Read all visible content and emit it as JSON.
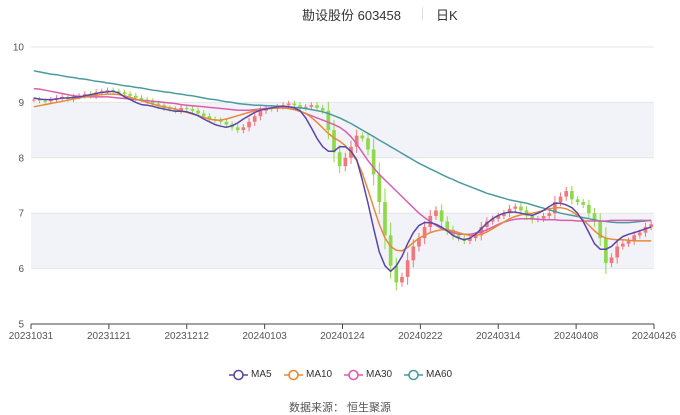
{
  "header": {
    "stock_label": "勘设股份 603458",
    "period_label": "日K"
  },
  "source": {
    "text": "数据来源：  恒生聚源"
  },
  "colors": {
    "up": "#f0787a",
    "down": "#8ed94b",
    "ma5": "#5b45a8",
    "ma10": "#e8893a",
    "ma30": "#d85fae",
    "ma60": "#4b9aa0",
    "band": "#f2f3f9",
    "grid": "#e6e6e6"
  },
  "chart_data": {
    "type": "candlestick",
    "ylim": [
      5,
      10
    ],
    "y_ticks": [
      "5",
      "6",
      "7",
      "8",
      "9",
      "10"
    ],
    "x_ticks": [
      "20231031",
      "20231121",
      "20231212",
      "20240103",
      "20240124",
      "20240222",
      "20240314",
      "20240408",
      "20240426"
    ],
    "legend": [
      "MA5",
      "MA10",
      "MA30",
      "MA60"
    ],
    "closes": [
      9.05,
      9.03,
      9.02,
      9.05,
      9.08,
      9.1,
      9.06,
      9.1,
      9.12,
      9.15,
      9.12,
      9.18,
      9.2,
      9.22,
      9.2,
      9.18,
      9.15,
      9.12,
      9.08,
      9.05,
      9.02,
      8.98,
      8.95,
      8.9,
      8.88,
      8.85,
      8.9,
      8.88,
      8.85,
      8.8,
      8.75,
      8.7,
      8.68,
      8.65,
      8.6,
      8.55,
      8.5,
      8.55,
      8.65,
      8.75,
      8.85,
      8.9,
      8.88,
      8.92,
      8.95,
      8.98,
      8.95,
      8.9,
      8.92,
      8.95,
      8.9,
      8.85,
      8.5,
      8.1,
      7.85,
      8.0,
      8.2,
      8.4,
      8.35,
      8.15,
      7.7,
      7.2,
      6.6,
      6.05,
      5.75,
      5.85,
      6.15,
      6.4,
      6.55,
      6.75,
      6.95,
      7.05,
      6.85,
      6.7,
      6.6,
      6.55,
      6.5,
      6.55,
      6.6,
      6.75,
      6.85,
      6.9,
      6.95,
      7.0,
      7.08,
      7.12,
      7.05,
      6.95,
      6.88,
      6.9,
      6.95,
      7.0,
      7.2,
      7.3,
      7.4,
      7.25,
      7.2,
      7.15,
      7.0,
      6.85,
      6.55,
      6.1,
      6.2,
      6.4,
      6.45,
      6.5,
      6.6,
      6.65,
      6.75,
      6.8
    ],
    "ma5": [
      9.08,
      9.06,
      9.05,
      9.05,
      9.06,
      9.08,
      9.08,
      9.09,
      9.1,
      9.12,
      9.14,
      9.16,
      9.18,
      9.19,
      9.2,
      9.17,
      9.1,
      9.05,
      9.0,
      8.96,
      8.95,
      8.93,
      8.9,
      8.88,
      8.86,
      8.84,
      8.84,
      8.83,
      8.8,
      8.76,
      8.7,
      8.65,
      8.6,
      8.57,
      8.55,
      8.58,
      8.63,
      8.7,
      8.76,
      8.82,
      8.86,
      8.88,
      8.9,
      8.92,
      8.93,
      8.92,
      8.9,
      8.85,
      8.72,
      8.54,
      8.35,
      8.2,
      8.12,
      8.12,
      8.2,
      8.2,
      8.12,
      7.97,
      7.6,
      7.18,
      6.72,
      6.3,
      6.05,
      5.95,
      6.05,
      6.22,
      6.45,
      6.65,
      6.78,
      6.83,
      6.83,
      6.8,
      6.75,
      6.68,
      6.6,
      6.55,
      6.52,
      6.55,
      6.62,
      6.72,
      6.82,
      6.9,
      6.96,
      7.0,
      7.02,
      7.02,
      7.0,
      6.98,
      6.96,
      7.0,
      7.05,
      7.12,
      7.18,
      7.18,
      7.15,
      7.1,
      7.0,
      6.85,
      6.65,
      6.45,
      6.35,
      6.35,
      6.4,
      6.5,
      6.58,
      6.62,
      6.65,
      6.68,
      6.72,
      6.75
    ],
    "ma10": [
      8.92,
      8.94,
      8.96,
      8.98,
      9.0,
      9.02,
      9.04,
      9.06,
      9.08,
      9.1,
      9.12,
      9.13,
      9.14,
      9.15,
      9.15,
      9.14,
      9.12,
      9.09,
      9.06,
      9.03,
      9.0,
      8.97,
      8.94,
      8.92,
      8.9,
      8.88,
      8.85,
      8.82,
      8.79,
      8.76,
      8.73,
      8.7,
      8.68,
      8.68,
      8.7,
      8.73,
      8.76,
      8.79,
      8.82,
      8.85,
      8.87,
      8.88,
      8.89,
      8.9,
      8.9,
      8.89,
      8.87,
      8.84,
      8.8,
      8.73,
      8.64,
      8.54,
      8.44,
      8.36,
      8.3,
      8.22,
      8.1,
      7.95,
      7.72,
      7.42,
      7.1,
      6.8,
      6.55,
      6.4,
      6.33,
      6.32,
      6.38,
      6.47,
      6.55,
      6.6,
      6.65,
      6.68,
      6.7,
      6.7,
      6.68,
      6.65,
      6.62,
      6.6,
      6.6,
      6.62,
      6.66,
      6.72,
      6.78,
      6.84,
      6.9,
      6.94,
      6.97,
      6.99,
      7.0,
      7.02,
      7.05,
      7.08,
      7.1,
      7.1,
      7.08,
      7.03,
      6.96,
      6.88,
      6.78,
      6.68,
      6.6,
      6.55,
      6.53,
      6.52,
      6.52,
      6.51,
      6.5,
      6.5,
      6.5,
      6.5
    ],
    "ma30": [
      9.25,
      9.24,
      9.22,
      9.2,
      9.18,
      9.16,
      9.14,
      9.12,
      9.11,
      9.1,
      9.1,
      9.1,
      9.1,
      9.1,
      9.09,
      9.08,
      9.07,
      9.06,
      9.05,
      9.04,
      9.03,
      9.02,
      9.01,
      9.0,
      8.99,
      8.98,
      8.96,
      8.95,
      8.94,
      8.93,
      8.92,
      8.91,
      8.9,
      8.89,
      8.88,
      8.87,
      8.86,
      8.86,
      8.86,
      8.87,
      8.88,
      8.89,
      8.9,
      8.9,
      8.9,
      8.89,
      8.87,
      8.84,
      8.8,
      8.76,
      8.72,
      8.68,
      8.64,
      8.6,
      8.55,
      8.48,
      8.38,
      8.25,
      8.1,
      7.95,
      7.82,
      7.7,
      7.6,
      7.5,
      7.4,
      7.3,
      7.2,
      7.1,
      7.0,
      6.92,
      6.85,
      6.78,
      6.72,
      6.68,
      6.65,
      6.62,
      6.62,
      6.62,
      6.64,
      6.66,
      6.7,
      6.75,
      6.8,
      6.84,
      6.87,
      6.89,
      6.9,
      6.9,
      6.9,
      6.89,
      6.88,
      6.88,
      6.88,
      6.87,
      6.87,
      6.87,
      6.86,
      6.86,
      6.86,
      6.86,
      6.86,
      6.86,
      6.87,
      6.87,
      6.87,
      6.87,
      6.87,
      6.87,
      6.87,
      6.87
    ],
    "ma60": [
      9.57,
      9.55,
      9.53,
      9.51,
      9.5,
      9.48,
      9.46,
      9.45,
      9.43,
      9.42,
      9.4,
      9.38,
      9.37,
      9.35,
      9.34,
      9.32,
      9.3,
      9.29,
      9.27,
      9.26,
      9.24,
      9.22,
      9.21,
      9.19,
      9.18,
      9.16,
      9.15,
      9.13,
      9.12,
      9.1,
      9.08,
      9.06,
      9.05,
      9.03,
      9.01,
      9.0,
      8.98,
      8.97,
      8.96,
      8.95,
      8.95,
      8.94,
      8.94,
      8.93,
      8.93,
      8.92,
      8.91,
      8.9,
      8.89,
      8.87,
      8.85,
      8.83,
      8.8,
      8.76,
      8.72,
      8.67,
      8.62,
      8.56,
      8.5,
      8.44,
      8.38,
      8.32,
      8.26,
      8.2,
      8.14,
      8.08,
      8.02,
      7.96,
      7.9,
      7.85,
      7.8,
      7.75,
      7.7,
      7.65,
      7.61,
      7.56,
      7.52,
      7.48,
      7.44,
      7.4,
      7.36,
      7.33,
      7.3,
      7.27,
      7.24,
      7.22,
      7.2,
      7.18,
      7.15,
      7.12,
      7.09,
      7.06,
      7.03,
      7.0,
      6.98,
      6.96,
      6.94,
      6.92,
      6.9,
      6.88,
      6.86,
      6.85,
      6.84,
      6.83,
      6.83,
      6.83,
      6.84,
      6.85,
      6.86,
      6.87
    ]
  }
}
